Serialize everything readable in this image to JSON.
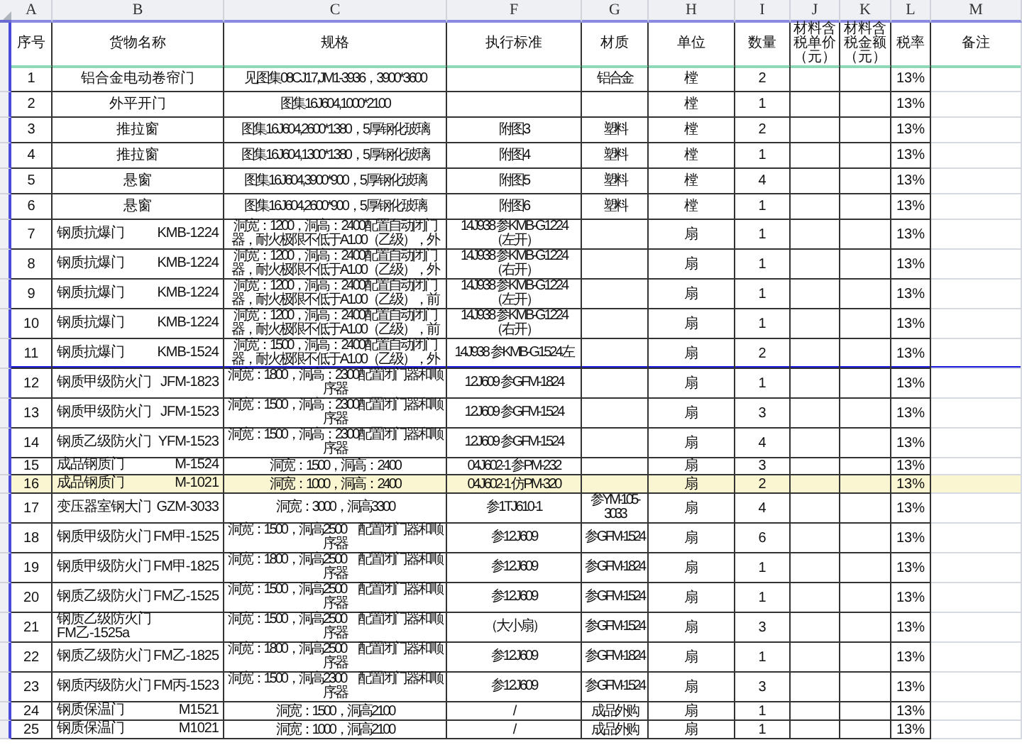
{
  "column_letters": [
    "A",
    "B",
    "C",
    "F",
    "G",
    "H",
    "I",
    "J",
    "K",
    "L",
    "M"
  ],
  "headers": [
    "序号",
    "货物名称",
    "规格",
    "执行标准",
    "材质",
    "单位",
    "数量",
    "材料含税单价（元）",
    "材料含税金额（元）",
    "税率",
    "备注"
  ],
  "rows": [
    {
      "no": "1",
      "name": "铝合金电动卷帘门",
      "spec": "见图集08CJ17,JM1-3936，3900*3600",
      "material": "铝合金",
      "unit": "樘",
      "qty": "2",
      "tax": "13%",
      "selected": false
    },
    {
      "no": "2",
      "name": "外平开门",
      "spec": "图集16J604,1000*2100",
      "unit": "樘",
      "qty": "1",
      "tax": "13%",
      "selected": false
    },
    {
      "no": "3",
      "name": "推拉窗",
      "spec": "图集16J604,2600*1380，5厚钢化玻璃",
      "standard": "附图3",
      "material": "塑料",
      "unit": "樘",
      "qty": "2",
      "tax": "13%",
      "selected": false
    },
    {
      "no": "4",
      "name": "推拉窗",
      "spec": "图集16J604,1300*1380，5厚钢化玻璃",
      "standard": "附图4",
      "material": "塑料",
      "unit": "樘",
      "qty": "1",
      "tax": "13%",
      "selected": false
    },
    {
      "no": "5",
      "name": "悬窗",
      "spec": "图集16J604,3900*900，5厚钢化玻璃",
      "standard": "附图5",
      "material": "塑料",
      "unit": "樘",
      "qty": "4",
      "tax": "13%",
      "selected": false
    },
    {
      "no": "6",
      "name": "悬窗",
      "spec": "图集16J604,2600*900，5厚钢化玻璃",
      "standard": "附图6",
      "material": "塑料",
      "unit": "樘",
      "qty": "1",
      "tax": "13%",
      "selected": false
    },
    {
      "no": "7",
      "name": "钢质抗爆门",
      "code": "KMB-1224",
      "spec": "洞宽：1200，洞高：2400配置自动闭门器，耐火极限不低于A1.00（乙级），外",
      "standard": "14J938 参KMB-G1224（左开）",
      "unit": "扇",
      "qty": "1",
      "tax": "13%",
      "selected": false
    },
    {
      "no": "8",
      "name": "钢质抗爆门",
      "code": "KMB-1224",
      "spec": "洞宽：1200，洞高：2400配置自动闭门器，耐火极限不低于A1.00（乙级），外",
      "standard": "14J938 参KMB-G1224（右开）",
      "unit": "扇",
      "qty": "1",
      "tax": "13%",
      "selected": false
    },
    {
      "no": "9",
      "name": "钢质抗爆门",
      "code": "KMB-1224",
      "spec": "洞宽：1200，洞高：2400配置自动闭门器，耐火极限不低于A1.00（乙级），前",
      "standard": "14J938 参KMB-G1224（左开）",
      "unit": "扇",
      "qty": "1",
      "tax": "13%",
      "selected": false
    },
    {
      "no": "10",
      "name": "钢质抗爆门",
      "code": "KMB-1224",
      "spec": "洞宽：1200，洞高：2400配置自动闭门器，耐火极限不低于A1.00（乙级），前",
      "standard": "14J938 参KMB-G1224（右开）",
      "unit": "扇",
      "qty": "1",
      "tax": "13%",
      "selected": false
    },
    {
      "no": "11",
      "name": "钢质抗爆门",
      "code": "KMB-1524",
      "spec": "洞宽：1500，洞高：2400配置自动闭门器，耐火极限不低于A1.00（乙级），外",
      "standard": "14J938 参KMB-G1524左",
      "unit": "扇",
      "qty": "2",
      "tax": "13%",
      "selected": false
    },
    {
      "no": "12",
      "name": "钢质甲级防火门",
      "code": "JFM-1823",
      "spec": "洞宽：1800，洞高：2300配置闭门器和顺序器",
      "standard": "12J609 参GFM-1824",
      "unit": "扇",
      "qty": "1",
      "tax": "13%",
      "selected": false
    },
    {
      "no": "13",
      "name": "钢质甲级防火门",
      "code": "JFM-1523",
      "spec": "洞宽：1500，洞高：2300配置闭门器和顺序器",
      "standard": "12J609 参GFM-1524",
      "unit": "扇",
      "qty": "3",
      "tax": "13%",
      "selected": false
    },
    {
      "no": "14",
      "name": "钢质乙级防火门",
      "code": "YFM-1523",
      "spec": "洞宽：1500，洞高：2300配置闭门器和顺序器",
      "standard": "12J609 参GFM-1524",
      "unit": "扇",
      "qty": "4",
      "tax": "13%",
      "selected": false
    },
    {
      "no": "15",
      "name": "成品钢质门",
      "code": "M-1524",
      "spec": "洞宽：1500，洞高：2400",
      "standard": "04J602-1 参PM-232",
      "unit": "扇",
      "qty": "3",
      "tax": "13%",
      "selected": false
    },
    {
      "no": "16",
      "name": "成品钢质门",
      "code": "M-1021",
      "spec": "洞宽：1000，洞高：2400",
      "standard": "04J602-1 仿PM-320",
      "unit": "扇",
      "qty": "2",
      "tax": "13%",
      "selected": true
    },
    {
      "no": "17",
      "name": "变压器室钢大门",
      "code": "GZM-3033",
      "spec": "洞宽：3000，洞高3300",
      "standard": "参1TJ610-1",
      "material": "参YM-105-3033",
      "unit": "扇",
      "qty": "4",
      "tax": "13%",
      "selected": false
    },
    {
      "no": "18",
      "name": "钢质甲级防火门",
      "code": "FM甲-1525",
      "spec": "洞宽：1500，洞高2500　配置闭门器和顺序器",
      "standard": "参12J609",
      "material": "参GFM-1524",
      "unit": "扇",
      "qty": "6",
      "tax": "13%",
      "selected": false
    },
    {
      "no": "19",
      "name": "钢质甲级防火门",
      "code": "FM甲-1825",
      "spec": "洞宽：1800，洞高2500　配置闭门器和顺序器",
      "standard": "参12J609",
      "material": "参GFM-1824",
      "unit": "扇",
      "qty": "1",
      "tax": "13%",
      "selected": false
    },
    {
      "no": "20",
      "name": "钢质乙级防火门",
      "code": "FM乙-1525",
      "spec": "洞宽：1500，洞高2500　配置闭门器和顺序器",
      "standard": "参12J609",
      "material": "参GFM-1524",
      "unit": "扇",
      "qty": "1",
      "tax": "13%",
      "selected": false
    },
    {
      "no": "21",
      "name": "钢质乙级防火门",
      "code": "FM乙-1525a",
      "spec": "洞宽：1500，洞高2500　配置闭门器和顺序器",
      "standard": "（大小扇）",
      "material": "参GFM-1524",
      "unit": "扇",
      "qty": "3",
      "tax": "13%",
      "selected": false
    },
    {
      "no": "22",
      "name": "钢质乙级防火门",
      "code": "FM乙-1825",
      "spec": "洞宽：1800，洞高2500　配置闭门器和顺序器",
      "standard": "参12J609",
      "material": "参GFM-1824",
      "unit": "扇",
      "qty": "1",
      "tax": "13%",
      "selected": false
    },
    {
      "no": "23",
      "name": "钢质丙级防火门",
      "code": "FM丙-1523",
      "spec": "洞宽：1500，洞高2300　配置闭门器和顺序器",
      "standard": "参12J609",
      "material": "参GFM-1524",
      "unit": "扇",
      "qty": "3",
      "tax": "13%",
      "selected": false
    },
    {
      "no": "24",
      "name": "钢质保温门",
      "code": "M1521",
      "spec": "洞宽：1500，洞高2100",
      "standard": "/",
      "material": "成品外购",
      "unit": "扇",
      "qty": "1",
      "tax": "13%",
      "selected": false
    },
    {
      "no": "25",
      "name": "钢质保温门",
      "code": "M1021",
      "spec": "洞宽：1000，洞高2100",
      "standard": "/",
      "material": "成品外购",
      "unit": "扇",
      "qty": "1",
      "tax": "13%",
      "selected": false
    }
  ]
}
